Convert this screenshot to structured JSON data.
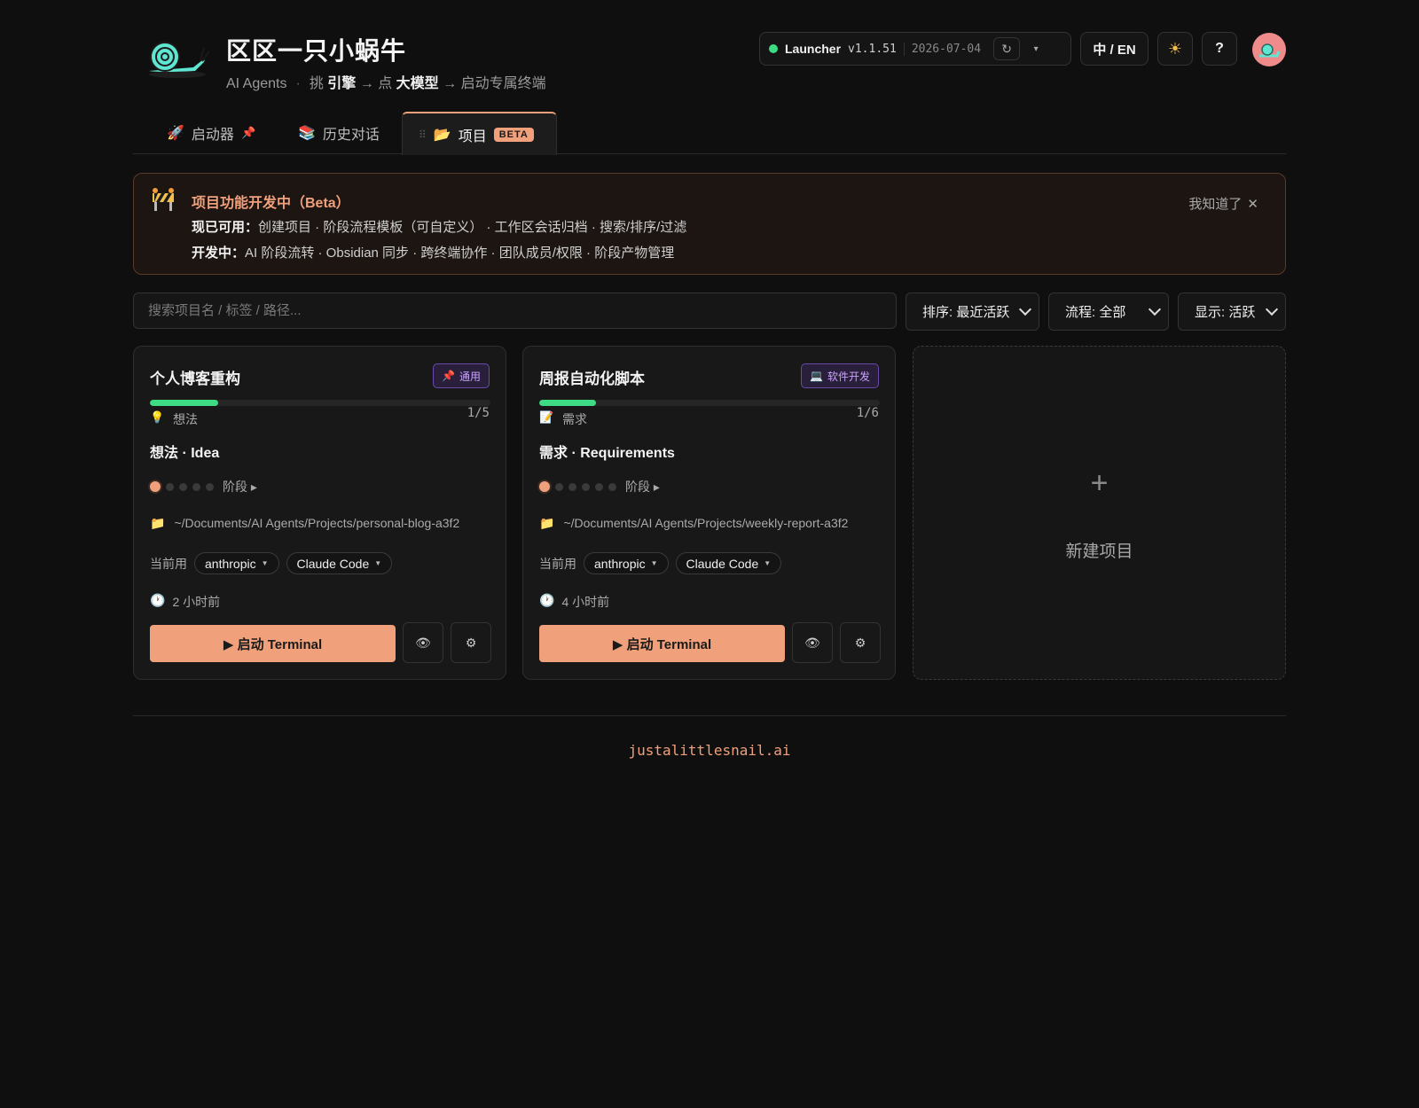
{
  "header": {
    "title": "区区一只小蜗牛",
    "subtitle_prefix": "AI Agents",
    "subtitle_sep": "·",
    "subtitle_pick": "挑",
    "subtitle_engine": "引擎",
    "subtitle_arrow1": "→ 点",
    "subtitle_model": "大模型",
    "subtitle_rest": "→ 启动专属终端",
    "logo_icon": "snail-logo",
    "launcher": {
      "name": "Launcher",
      "version": "v1.1.51",
      "date": "2026-07-04",
      "refresh_icon": "↻",
      "caret": "▾",
      "status_color": "#3ddc84"
    },
    "lang_label": "中 / EN",
    "theme_icon": "☀",
    "help_label": "?"
  },
  "tabs": [
    {
      "icon": "🚀",
      "label": "启动器",
      "pin": "📌"
    },
    {
      "icon": "📚",
      "label": "历史对话"
    },
    {
      "handle": "⠿",
      "icon": "📂",
      "label": "项目",
      "badge": "BETA",
      "active": true
    }
  ],
  "banner": {
    "title": "项目功能开发中（Beta）",
    "available_label": "现已可用：",
    "available_text": "创建项目 · 阶段流程模板（可自定义） · 工作区会话归档 · 搜索/排序/过滤",
    "dev_label": "开发中：",
    "dev_text": "AI 阶段流转 · Obsidian 同步 · 跨终端协作 · 团队成员/权限 · 阶段产物管理",
    "dismiss_label": "我知道了",
    "dismiss_icon": "✕"
  },
  "filters": {
    "search_placeholder": "搜索项目名 / 标签 / 路径...",
    "sort": "排序: 最近活跃",
    "flow": "流程: 全部",
    "show": "显示: 活跃"
  },
  "projects": [
    {
      "name": "个人博客重构",
      "tag_icon": "📌",
      "tag": "通用",
      "progress": 0.2,
      "stage_icon": "💡",
      "stage_short": "想法",
      "stage_count": "1/5",
      "stage_full": "想法 · Idea",
      "stage_total": 5,
      "stage_dots_label": "阶段 ▸",
      "path_icon": "📁",
      "path": "~/Documents/AI Agents/Projects/personal-blog-a3f2",
      "current_label": "当前用",
      "provider": "anthropic",
      "tool": "Claude Code",
      "time_icon": "🕐",
      "time": "2 小时前",
      "launch_label": "▶ 启动 Terminal",
      "view_icon": "👁",
      "settings_icon": "⚙"
    },
    {
      "name": "周报自动化脚本",
      "tag_icon": "💻",
      "tag": "软件开发",
      "progress": 0.1667,
      "stage_icon": "📝",
      "stage_short": "需求",
      "stage_count": "1/6",
      "stage_full": "需求 · Requirements",
      "stage_total": 6,
      "stage_dots_label": "阶段 ▸",
      "path_icon": "📁",
      "path": "~/Documents/AI Agents/Projects/weekly-report-a3f2",
      "current_label": "当前用",
      "provider": "anthropic",
      "tool": "Claude Code",
      "time_icon": "🕐",
      "time": "4 小时前",
      "launch_label": "▶ 启动 Terminal",
      "view_icon": "👁",
      "settings_icon": "⚙"
    }
  ],
  "new_project": {
    "plus": "+",
    "label": "新建项目"
  },
  "footer": {
    "text": "justalittlesnail.ai"
  },
  "colors": {
    "accent": "#f0a07a",
    "progress": "#3ddc84",
    "tag": "#c9a3ff"
  }
}
